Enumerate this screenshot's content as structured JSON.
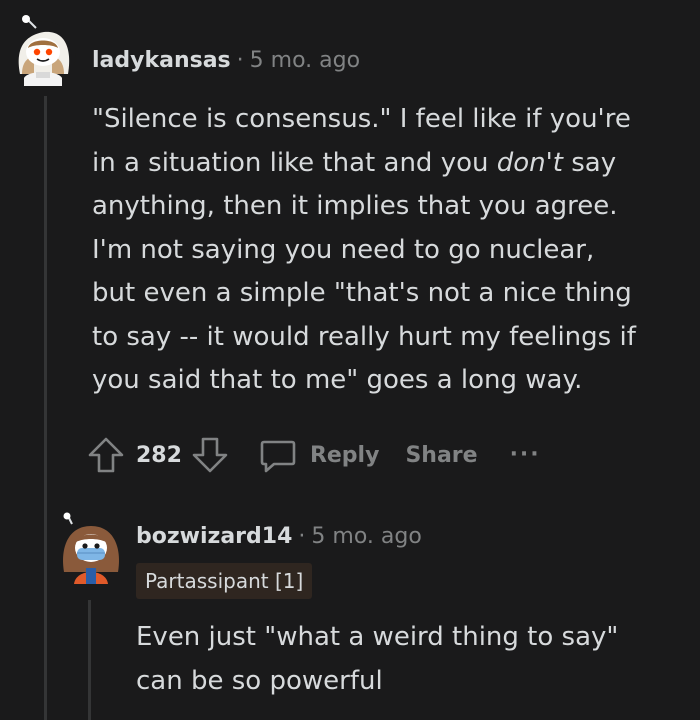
{
  "comment": {
    "username": "ladykansas",
    "separator": "·",
    "time": "5 mo. ago",
    "avatar_icon": "snoo-avatar-icon",
    "body_lines": [
      "\"Silence is consensus.\" I feel like if you're",
      "in a situation like that and you ",
      "don't",
      " say",
      "anything, then it implies that you agree.",
      "I'm not saying you need to go nuclear,",
      "but even a simple \"that's not a nice thing",
      "to say -- it would really hurt my feelings if",
      "you said that to me\" goes a long way."
    ],
    "votes": "282",
    "reply_label": "Reply",
    "share_label": "Share",
    "more_label": "···"
  },
  "reply": {
    "username": "bozwizard14",
    "separator": "·",
    "time": "5 mo. ago",
    "avatar_icon": "snoo-avatar-icon",
    "flair": "Partassipant [1]",
    "body_lines": [
      "Even just \"what a weird thing to say\"",
      "can be so powerful"
    ]
  },
  "colors": {
    "background": "#1a1a1b",
    "text": "#d7dadc",
    "muted": "#818384",
    "thread_line": "#343536",
    "flair_bg": "#2f2620"
  }
}
